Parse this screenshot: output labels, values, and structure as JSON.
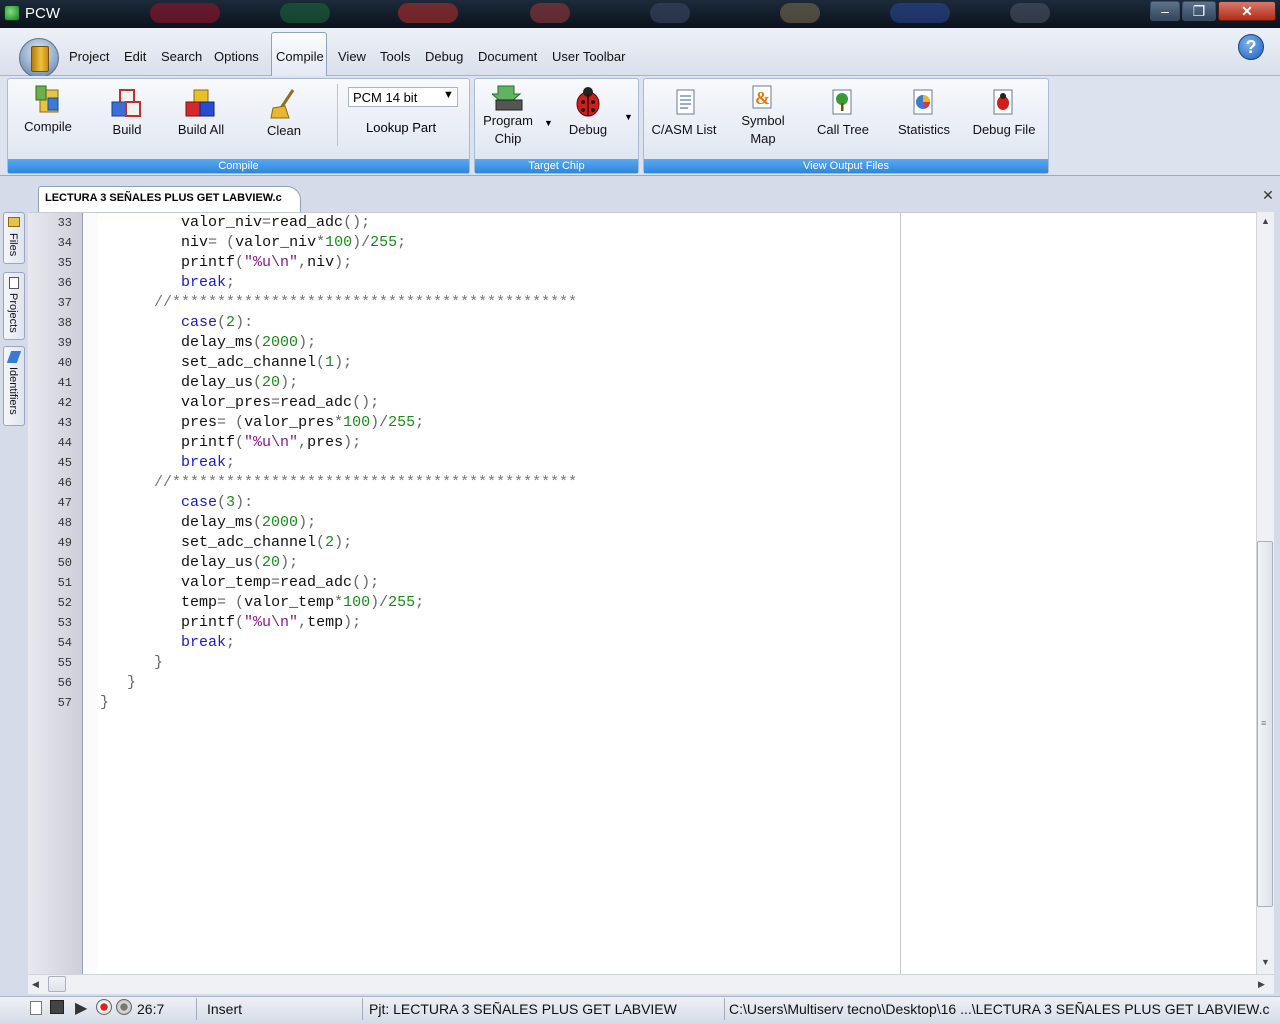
{
  "window": {
    "title": "PCW"
  },
  "menu": {
    "items": [
      "Project",
      "Edit",
      "Search",
      "Options",
      "Compile",
      "View",
      "Tools",
      "Debug",
      "Document",
      "User Toolbar"
    ],
    "active": "Compile",
    "help_label": "?"
  },
  "ribbon": {
    "compile_group": {
      "label": "Compile",
      "compile": "Compile",
      "build": "Build",
      "build_all": "Build All",
      "clean": "Clean",
      "pcm_select": "PCM 14 bit",
      "lookup_part": "Lookup Part"
    },
    "target_group": {
      "label": "Target Chip",
      "program_chip_1": "Program",
      "program_chip_2": "Chip",
      "debug": "Debug"
    },
    "output_group": {
      "label": "View Output Files",
      "casm": "C/ASM List",
      "symbol_map_1": "Symbol",
      "symbol_map_2": "Map",
      "call_tree": "Call Tree",
      "statistics": "Statistics",
      "debug_file": "Debug File"
    }
  },
  "sidebar": {
    "files": "Files",
    "projects": "Projects",
    "identifiers": "Identifiers"
  },
  "document": {
    "tab_title": "LECTURA 3 SEÑALES PLUS GET LABVIEW.c"
  },
  "code": {
    "lines": [
      {
        "n": "33",
        "tokens": [
          [
            "i",
            "         "
          ],
          [
            "t",
            "valor_niv"
          ],
          [
            "o",
            "="
          ],
          [
            "t",
            "read_adc"
          ],
          [
            "o",
            "();"
          ]
        ]
      },
      {
        "n": "34",
        "tokens": [
          [
            "i",
            "         "
          ],
          [
            "t",
            "niv"
          ],
          [
            "o",
            "= "
          ],
          [
            "o",
            "("
          ],
          [
            "t",
            "valor_niv"
          ],
          [
            "o",
            "*"
          ],
          [
            "n",
            "100"
          ],
          [
            "o",
            ")/"
          ],
          [
            "n",
            "255"
          ],
          [
            "o",
            ";"
          ]
        ]
      },
      {
        "n": "35",
        "tokens": [
          [
            "i",
            "         "
          ],
          [
            "t",
            "printf"
          ],
          [
            "o",
            "("
          ],
          [
            "s",
            "\"%u\\n\""
          ],
          [
            "o",
            ","
          ],
          [
            "t",
            "niv"
          ],
          [
            "o",
            ");"
          ]
        ]
      },
      {
        "n": "36",
        "tokens": [
          [
            "i",
            "         "
          ],
          [
            "k",
            "break"
          ],
          [
            "o",
            ";"
          ]
        ]
      },
      {
        "n": "37",
        "tokens": [
          [
            "i",
            "      "
          ],
          [
            "c",
            "//*********************************************"
          ]
        ]
      },
      {
        "n": "38",
        "tokens": [
          [
            "i",
            "         "
          ],
          [
            "k",
            "case"
          ],
          [
            "o",
            "("
          ],
          [
            "n",
            "2"
          ],
          [
            "o",
            "):"
          ]
        ]
      },
      {
        "n": "39",
        "tokens": [
          [
            "i",
            "         "
          ],
          [
            "t",
            "delay_ms"
          ],
          [
            "o",
            "("
          ],
          [
            "n",
            "2000"
          ],
          [
            "o",
            ");"
          ]
        ]
      },
      {
        "n": "40",
        "tokens": [
          [
            "i",
            "         "
          ],
          [
            "t",
            "set_adc_channel"
          ],
          [
            "o",
            "("
          ],
          [
            "n",
            "1"
          ],
          [
            "o",
            ");"
          ]
        ]
      },
      {
        "n": "41",
        "tokens": [
          [
            "i",
            "         "
          ],
          [
            "t",
            "delay_us"
          ],
          [
            "o",
            "("
          ],
          [
            "n",
            "20"
          ],
          [
            "o",
            ");"
          ]
        ]
      },
      {
        "n": "42",
        "tokens": [
          [
            "i",
            "         "
          ],
          [
            "t",
            "valor_pres"
          ],
          [
            "o",
            "="
          ],
          [
            "t",
            "read_adc"
          ],
          [
            "o",
            "();"
          ]
        ]
      },
      {
        "n": "43",
        "tokens": [
          [
            "i",
            "         "
          ],
          [
            "t",
            "pres"
          ],
          [
            "o",
            "= "
          ],
          [
            "o",
            "("
          ],
          [
            "t",
            "valor_pres"
          ],
          [
            "o",
            "*"
          ],
          [
            "n",
            "100"
          ],
          [
            "o",
            ")/"
          ],
          [
            "n",
            "255"
          ],
          [
            "o",
            ";"
          ]
        ]
      },
      {
        "n": "44",
        "tokens": [
          [
            "i",
            "         "
          ],
          [
            "t",
            "printf"
          ],
          [
            "o",
            "("
          ],
          [
            "s",
            "\"%u\\n\""
          ],
          [
            "o",
            ","
          ],
          [
            "t",
            "pres"
          ],
          [
            "o",
            ");"
          ]
        ]
      },
      {
        "n": "45",
        "tokens": [
          [
            "i",
            "         "
          ],
          [
            "k",
            "break"
          ],
          [
            "o",
            ";"
          ]
        ]
      },
      {
        "n": "46",
        "tokens": [
          [
            "i",
            "      "
          ],
          [
            "c",
            "//*********************************************"
          ]
        ]
      },
      {
        "n": "47",
        "tokens": [
          [
            "i",
            "         "
          ],
          [
            "k",
            "case"
          ],
          [
            "o",
            "("
          ],
          [
            "n",
            "3"
          ],
          [
            "o",
            "):"
          ]
        ]
      },
      {
        "n": "48",
        "tokens": [
          [
            "i",
            "         "
          ],
          [
            "t",
            "delay_ms"
          ],
          [
            "o",
            "("
          ],
          [
            "n",
            "2000"
          ],
          [
            "o",
            ");"
          ]
        ]
      },
      {
        "n": "49",
        "tokens": [
          [
            "i",
            "         "
          ],
          [
            "t",
            "set_adc_channel"
          ],
          [
            "o",
            "("
          ],
          [
            "n",
            "2"
          ],
          [
            "o",
            ");"
          ]
        ]
      },
      {
        "n": "50",
        "tokens": [
          [
            "i",
            "         "
          ],
          [
            "t",
            "delay_us"
          ],
          [
            "o",
            "("
          ],
          [
            "n",
            "20"
          ],
          [
            "o",
            ");"
          ]
        ]
      },
      {
        "n": "51",
        "tokens": [
          [
            "i",
            "         "
          ],
          [
            "t",
            "valor_temp"
          ],
          [
            "o",
            "="
          ],
          [
            "t",
            "read_adc"
          ],
          [
            "o",
            "();"
          ]
        ]
      },
      {
        "n": "52",
        "tokens": [
          [
            "i",
            "         "
          ],
          [
            "t",
            "temp"
          ],
          [
            "o",
            "= "
          ],
          [
            "o",
            "("
          ],
          [
            "t",
            "valor_temp"
          ],
          [
            "o",
            "*"
          ],
          [
            "n",
            "100"
          ],
          [
            "o",
            ")/"
          ],
          [
            "n",
            "255"
          ],
          [
            "o",
            ";"
          ]
        ]
      },
      {
        "n": "53",
        "tokens": [
          [
            "i",
            "         "
          ],
          [
            "t",
            "printf"
          ],
          [
            "o",
            "("
          ],
          [
            "s",
            "\"%u\\n\""
          ],
          [
            "o",
            ","
          ],
          [
            "t",
            "temp"
          ],
          [
            "o",
            ");"
          ]
        ]
      },
      {
        "n": "54",
        "tokens": [
          [
            "i",
            "         "
          ],
          [
            "k",
            "break"
          ],
          [
            "o",
            ";"
          ]
        ]
      },
      {
        "n": "55",
        "tokens": [
          [
            "i",
            "      "
          ],
          [
            "o",
            "}"
          ]
        ]
      },
      {
        "n": "56",
        "tokens": [
          [
            "i",
            "   "
          ],
          [
            "o",
            "}"
          ]
        ]
      },
      {
        "n": "57",
        "tokens": [
          [
            "o",
            "}"
          ]
        ]
      }
    ]
  },
  "status": {
    "position": "26:7",
    "mode": "Insert",
    "project": "Pjt: LECTURA 3 SEÑALES PLUS GET LABVIEW",
    "path": "C:\\Users\\Multiserv tecno\\Desktop\\16 ...\\LECTURA 3 SEÑALES PLUS GET LABVIEW.c"
  },
  "colors": {
    "keyword": "#1a1ad2",
    "number": "#1e8a1e",
    "string": "#8a1a8a",
    "operator": "#666666",
    "comment": "#777777",
    "text": "#111111",
    "group_label": "#2e86e0"
  }
}
